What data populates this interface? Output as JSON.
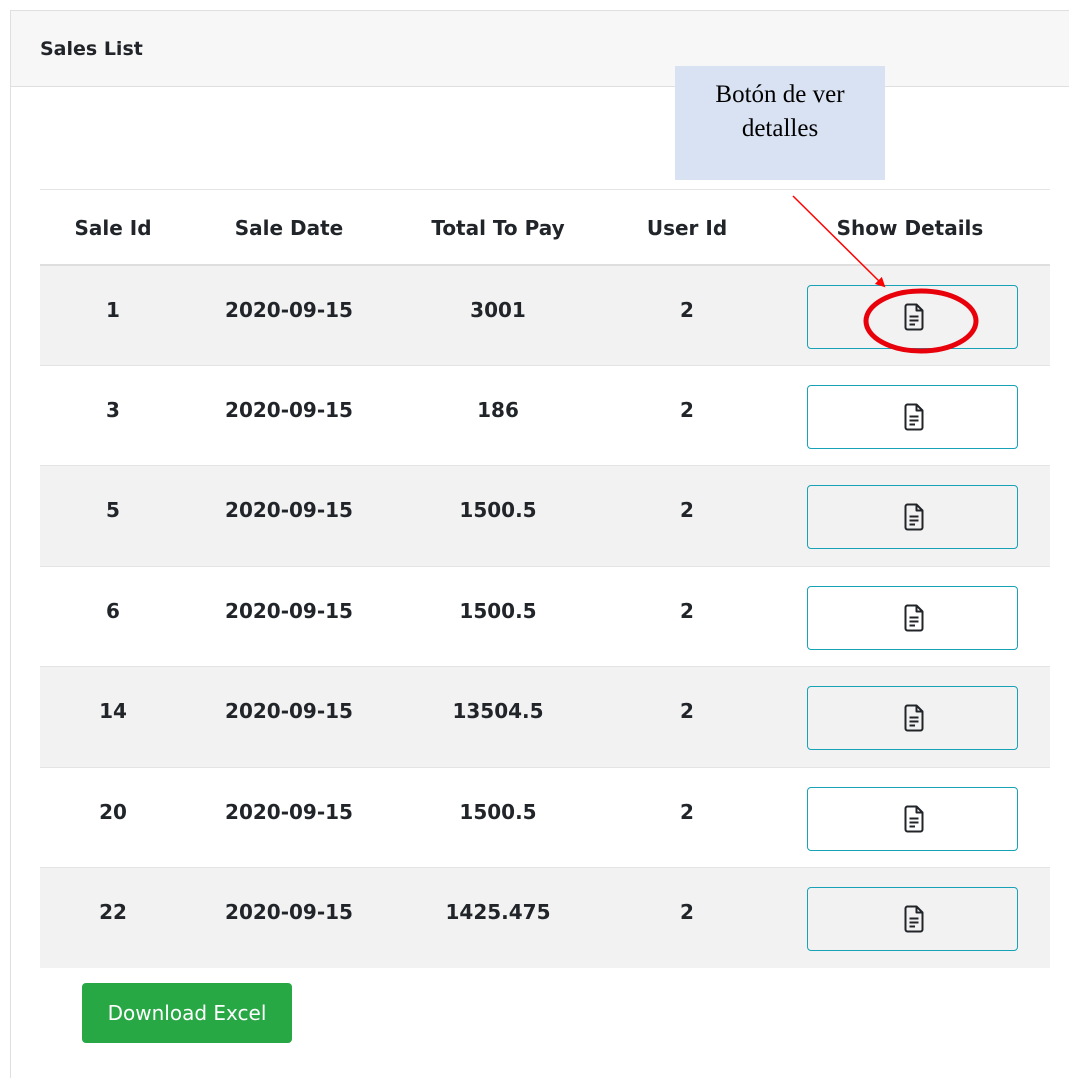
{
  "card": {
    "title": "Sales List"
  },
  "table": {
    "headers": [
      "Sale Id",
      "Sale Date",
      "Total To Pay",
      "User Id",
      "Show Details"
    ],
    "rows": [
      {
        "sale_id": "1",
        "sale_date": "2020-09-15",
        "total": "3001",
        "user_id": "2"
      },
      {
        "sale_id": "3",
        "sale_date": "2020-09-15",
        "total": "186",
        "user_id": "2"
      },
      {
        "sale_id": "5",
        "sale_date": "2020-09-15",
        "total": "1500.5",
        "user_id": "2"
      },
      {
        "sale_id": "6",
        "sale_date": "2020-09-15",
        "total": "1500.5",
        "user_id": "2"
      },
      {
        "sale_id": "14",
        "sale_date": "2020-09-15",
        "total": "13504.5",
        "user_id": "2"
      },
      {
        "sale_id": "20",
        "sale_date": "2020-09-15",
        "total": "1500.5",
        "user_id": "2"
      },
      {
        "sale_id": "22",
        "sale_date": "2020-09-15",
        "total": "1425.475",
        "user_id": "2"
      }
    ],
    "details_icon": "file-text-icon"
  },
  "download_button": {
    "label": "Download Excel"
  },
  "annotation": {
    "callout_lines": [
      "Botón de ver",
      "detalles"
    ],
    "arrow_color": "#ff0000",
    "highlight_color": "#e8000b",
    "callout_bg": "#d9e2f3"
  },
  "colors": {
    "header_bg": "#f7f7f7",
    "stripe_bg": "#f2f2f2",
    "info_outline": "#17a2b8",
    "success": "#28a745"
  }
}
